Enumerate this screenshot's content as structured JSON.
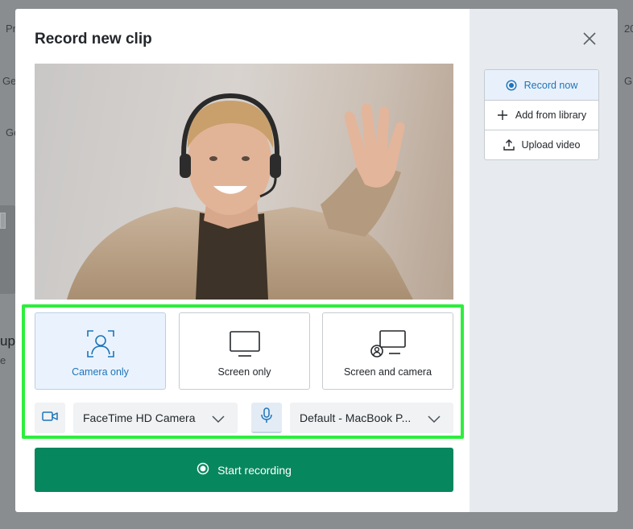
{
  "background": {
    "fragments": [
      "Pr",
      "Ge",
      "Ge",
      "up",
      "e",
      "20",
      "G"
    ]
  },
  "modal": {
    "title": "Record new clip",
    "modes": [
      {
        "label": "Camera only",
        "icon": "camera-person-icon",
        "active": true
      },
      {
        "label": "Screen only",
        "icon": "monitor-icon",
        "active": false
      },
      {
        "label": "Screen and camera",
        "icon": "screen-and-camera-icon",
        "active": false
      }
    ],
    "camera_select": {
      "value": "FaceTime HD Camera",
      "icon": "video-camera-icon"
    },
    "mic_select": {
      "value": "Default - MacBook P...",
      "icon": "microphone-icon"
    },
    "start_button": {
      "label": "Start recording"
    }
  },
  "side_menu": {
    "items": [
      {
        "label": "Record now",
        "icon": "radio-record-icon",
        "active": true
      },
      {
        "label": "Add from library",
        "icon": "plus-icon",
        "active": false
      },
      {
        "label": "Upload video",
        "icon": "upload-icon",
        "active": false
      }
    ]
  },
  "colors": {
    "accent_blue": "#1d74b9",
    "primary_green": "#07875e",
    "highlight_green": "#2dee3d"
  }
}
